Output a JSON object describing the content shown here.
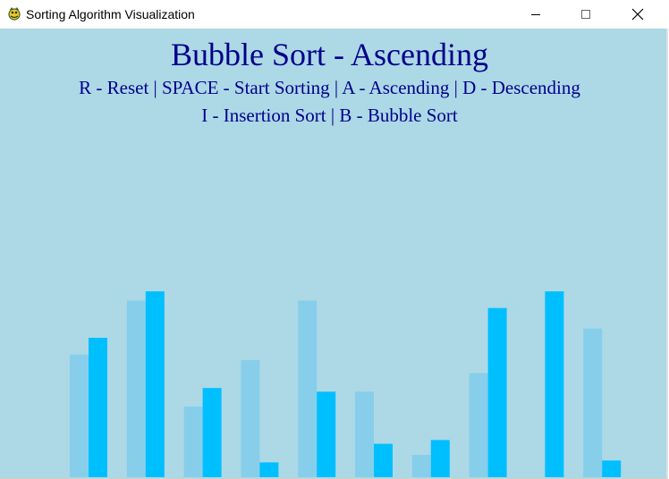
{
  "window": {
    "title": "Sorting Algorithm Visualization",
    "icon": "pygame-snake-icon",
    "controls": [
      "minimize-icon",
      "maximize-icon",
      "close-icon"
    ]
  },
  "hud": {
    "title": "Bubble Sort - Ascending",
    "controls_line1": "R - Reset | SPACE - Start Sorting | A - Ascending | D - Descending",
    "controls_line2": "I - Insertion Sort | B - Bubble Sort"
  },
  "colors": {
    "background": "#add8e6",
    "text": "#00008b",
    "bar_previous": "#87ceeb",
    "bar_current": "#00bfff"
  },
  "visualization": {
    "value_range": [
      0,
      100
    ],
    "groups": [
      {
        "previous": 66,
        "current": 75
      },
      {
        "previous": 95,
        "current": 100
      },
      {
        "previous": 38,
        "current": 48
      },
      {
        "previous": 63,
        "current": 8
      },
      {
        "previous": 95,
        "current": 46
      },
      {
        "previous": 46,
        "current": 18
      },
      {
        "previous": 12,
        "current": 20
      },
      {
        "previous": 56,
        "current": 91
      },
      {
        "previous": 0,
        "current": 100
      },
      {
        "previous": 80,
        "current": 9
      }
    ]
  }
}
